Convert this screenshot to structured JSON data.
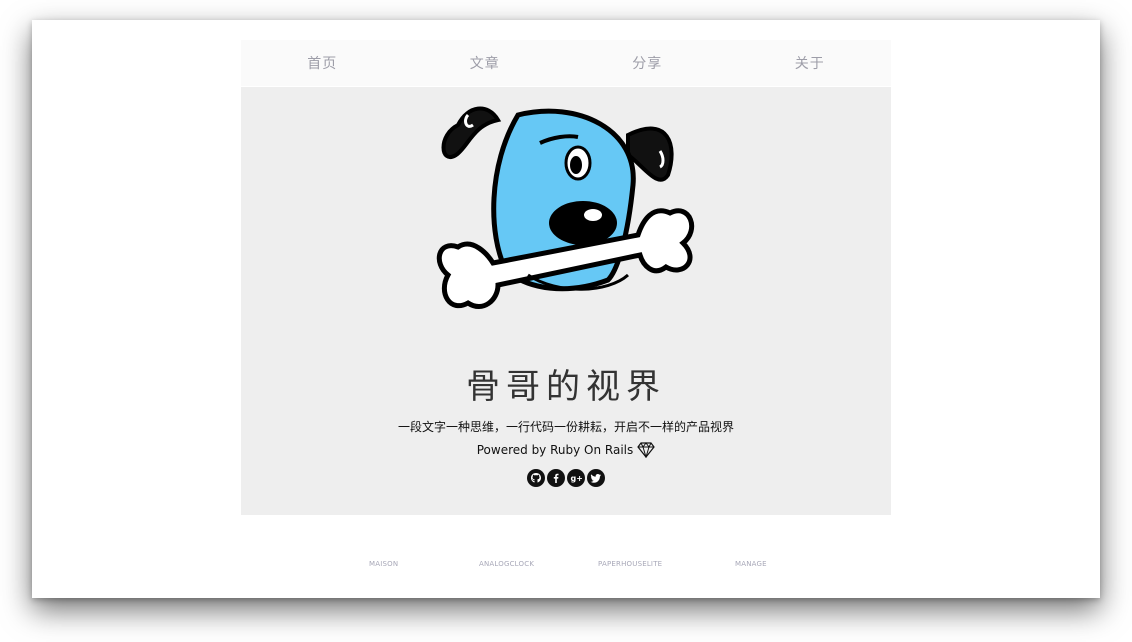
{
  "nav": {
    "items": [
      {
        "label": "首页"
      },
      {
        "label": "文章"
      },
      {
        "label": "分享"
      },
      {
        "label": "关于"
      }
    ]
  },
  "hero": {
    "mascot_icon": "dog-with-bone-logo",
    "title": "骨哥的视界",
    "tagline": "一段文字一种思维，一行代码一份耕耘，开启不一样的产品视界",
    "powered_by": "Powered by Ruby On Rails",
    "powered_icon": "ruby-gem-icon",
    "socials": [
      {
        "name": "github-icon"
      },
      {
        "name": "facebook-icon"
      },
      {
        "name": "google-plus-icon"
      },
      {
        "name": "twitter-icon"
      }
    ]
  },
  "footer": {
    "links": [
      {
        "label": "MAISON"
      },
      {
        "label": "ANALOGCLOCK"
      },
      {
        "label": "PAPERHOUSELITE"
      },
      {
        "label": "MANAGE"
      }
    ]
  },
  "colors": {
    "hero_bg": "#eeeeee",
    "nav_bg": "#fafafa",
    "nav_text": "#9d9da8",
    "mascot_blue": "#66c8f5"
  }
}
